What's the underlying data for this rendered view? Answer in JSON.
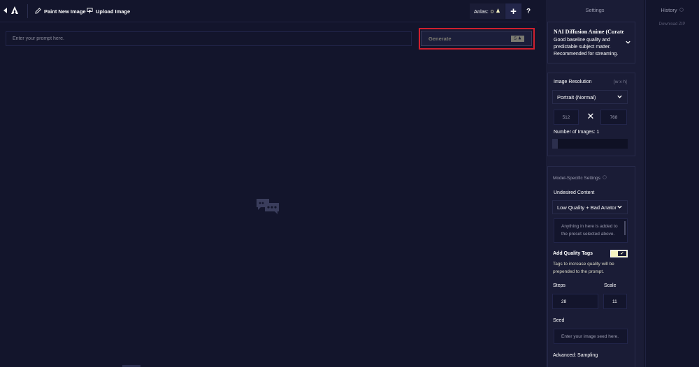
{
  "topbar": {
    "paint_label": "Paint New Image",
    "upload_label": "Upload Image",
    "anlas_label": "Anlas:",
    "anlas_value": "0",
    "plus": "+",
    "help": "?"
  },
  "prompt": {
    "placeholder": "Enter your prompt here.",
    "generate_label": "Generate",
    "generate_cost": "5"
  },
  "sidebar": {
    "settings_header": "Settings",
    "history_header": "History",
    "download_zip": "Download ZIP",
    "model": {
      "name": "NAI Diffusion Anime (Curated)",
      "description": "Good baseline quality and predictable subject matter. Recommended for streaming."
    },
    "resolution": {
      "title": "Image Resolution",
      "hint": "[w x h]",
      "preset": "Portrait (Normal)",
      "width": "512",
      "height": "768",
      "times": "✕",
      "num_images_label": "Number of Images:",
      "num_images_value": "1",
      "num_images_fraction": 0.0
    },
    "model_settings": {
      "title": "Model-Specific Settings",
      "undesired_label": "Undesired Content",
      "undesired_preset": "Low Quality + Bad Anatomy",
      "undesired_placeholder": "Anything in here is added to the preset selected above.",
      "quality_tags_label": "Add Quality Tags",
      "quality_tags_enabled": true,
      "quality_tags_desc": "Tags to increase quality will be prepended to the prompt.",
      "steps_label": "Steps",
      "steps_value": "28",
      "scale_label": "Scale",
      "scale_value": "11",
      "seed_label": "Seed",
      "seed_placeholder": "Enter your image seed here.",
      "advanced_label": "Advanced: Sampling"
    }
  },
  "colors": {
    "background": "#13152c",
    "panel": "#1a1c36",
    "accent": "#f5f3c2",
    "highlight": "#d0202e"
  },
  "icons": {
    "collapse": "chevron-left-icon",
    "logo": "novelai-logo-icon",
    "paint": "pencil-icon",
    "upload": "upload-icon",
    "anlas": "anlas-icon",
    "empty": "chat-bubbles-icon"
  }
}
